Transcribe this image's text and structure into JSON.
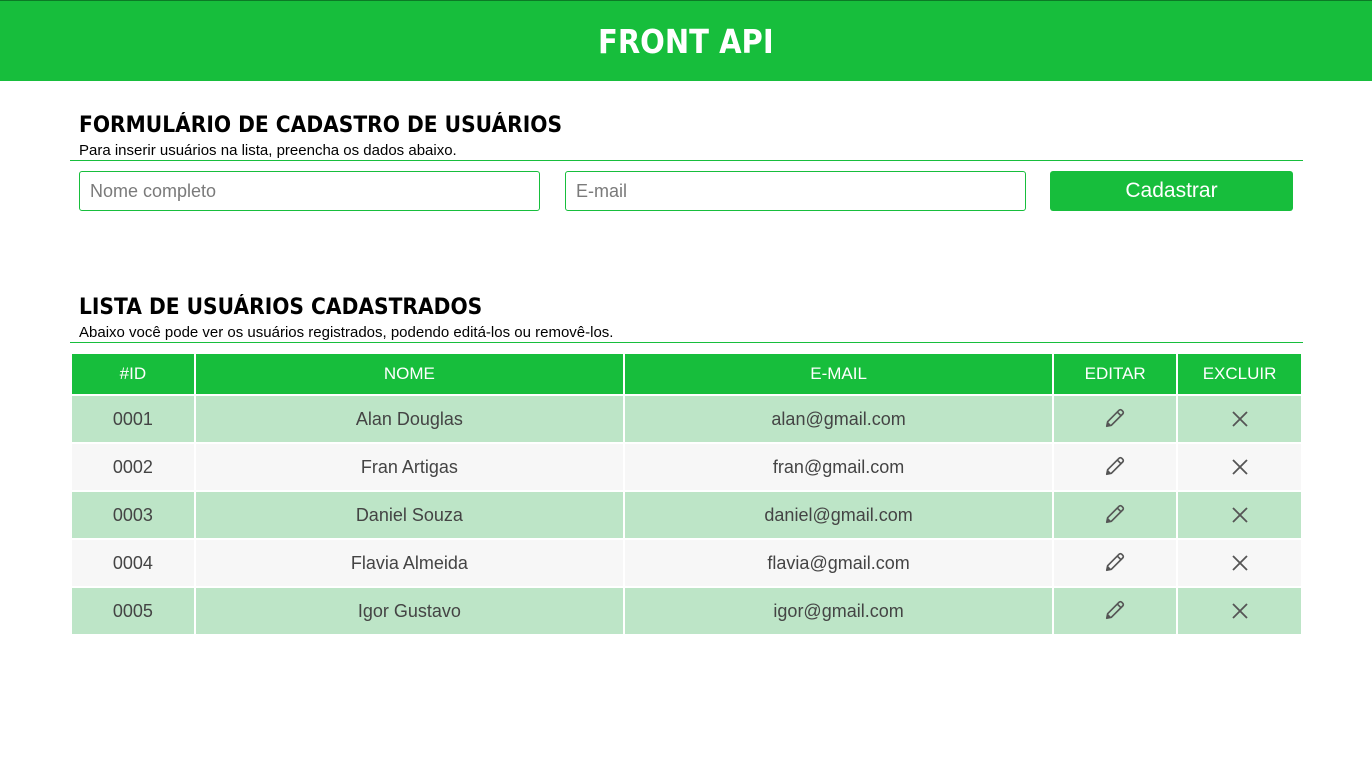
{
  "header": {
    "title": "FRONT API"
  },
  "form_section": {
    "title": "FORMULÁRIO DE CADASTRO DE USUÁRIOS",
    "subtitle": "Para inserir usuários na lista, preencha os dados abaixo.",
    "name_placeholder": "Nome completo",
    "email_placeholder": "E-mail",
    "submit_label": "Cadastrar"
  },
  "list_section": {
    "title": "LISTA DE USUÁRIOS CADASTRADOS",
    "subtitle": "Abaixo você pode ver os usuários registrados, podendo editá-los ou removê-los."
  },
  "table": {
    "headers": [
      "#ID",
      "NOME",
      "E-MAIL",
      "EDITAR",
      "EXCLUIR"
    ],
    "rows": [
      {
        "id": "0001",
        "name": "Alan Douglas",
        "email": "alan@gmail.com"
      },
      {
        "id": "0002",
        "name": "Fran Artigas",
        "email": "fran@gmail.com"
      },
      {
        "id": "0003",
        "name": "Daniel Souza",
        "email": "daniel@gmail.com"
      },
      {
        "id": "0004",
        "name": "Flavia Almeida",
        "email": "flavia@gmail.com"
      },
      {
        "id": "0005",
        "name": "Igor Gustavo",
        "email": "igor@gmail.com"
      }
    ],
    "edit_icon": "pencil-icon",
    "delete_icon": "close-icon"
  },
  "colors": {
    "accent": "#17be3c",
    "row_alt": "#bde5c7",
    "row_plain": "#f7f7f7"
  }
}
